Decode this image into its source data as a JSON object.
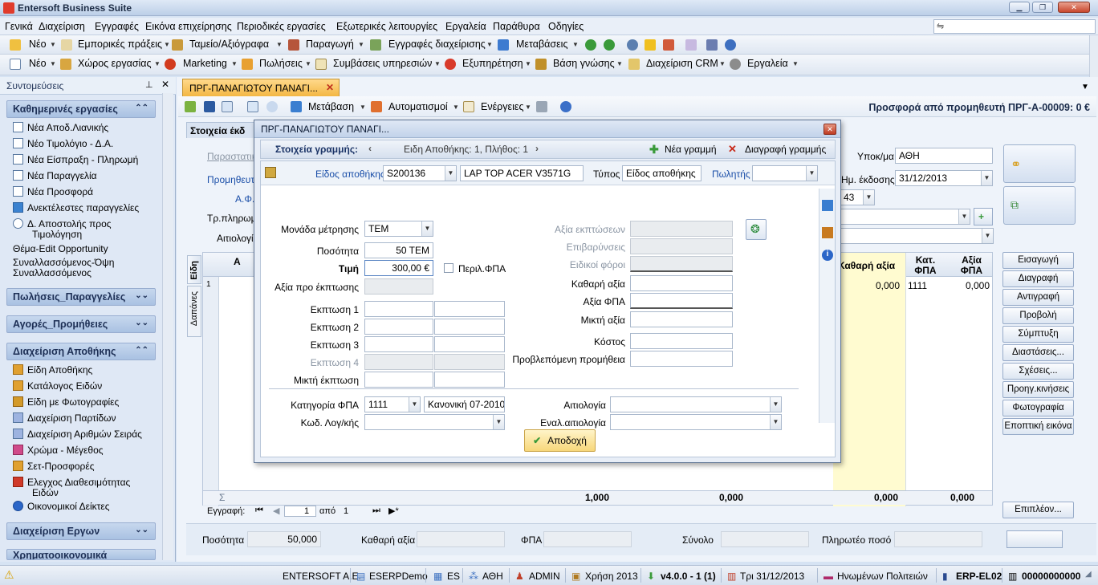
{
  "window": {
    "title": "Entersoft Business Suite"
  },
  "menu": [
    "Γενικά",
    "Διαχείριση",
    "Εγγραφές",
    "Εικόνα επιχείρησης",
    "Περιοδικές εργασίες",
    "Εξωτερικές λειτουργίες",
    "Εργαλεία",
    "Παράθυρα",
    "Οδηγίες"
  ],
  "toolbar1": [
    "Νέο",
    "Εμπορικές πράξεις",
    "Ταμείο/Αξιόγραφα",
    "Παραγωγή",
    "Εγγραφές διαχείρισης",
    "Μεταβάσεις"
  ],
  "toolbar2": [
    "Νέο",
    "Χώρος εργασίας",
    "Marketing",
    "Πωλήσεις",
    "Συμβάσεις υπηρεσιών",
    "Εξυπηρέτηση",
    "Βάση γνώσης",
    "Διαχείριση CRM",
    "Εργαλεία"
  ],
  "left": {
    "header": "Συντομεύσεις",
    "groups": [
      {
        "title": "Καθημερινές εργασίες",
        "items": [
          "Νέα Αποδ.Λιανικής",
          "Νέο Τιμολόγιο - Δ.Α.",
          "Νέα Είσπραξη - Πληρωμή",
          "Νέα Παραγγελία",
          "Νέα Προσφορά",
          "Ανεκτέλεστες παραγγελίες",
          "Δ. Αποστολής προς",
          "Τιμολόγηση",
          "Θέμα-Edit Opportunity",
          "Συναλλασσόμενος-Όψη",
          "Συναλλασσόμενος"
        ]
      },
      {
        "title": "Πωλήσεις_Παραγγελίες"
      },
      {
        "title": "Αγορές_Προμήθειες"
      },
      {
        "title": "Διαχείριση Αποθήκης",
        "items": [
          "Είδη Αποθήκης",
          "Κατάλογος Ειδών",
          "Είδη με Φωτογραφίες",
          "Διαχείριση Παρτίδων",
          "Διαχείριση Αριθμών Σειράς",
          "Χρώμα - Μέγεθος",
          "Σετ-Προσφορές",
          "Ελεγχος Διαθεσιμότητας",
          "Ειδών",
          "Οικονομικοί Δείκτες"
        ]
      },
      {
        "title": "Διαχείριση Εργων"
      },
      {
        "title": "Χρηματοοικονομικά"
      }
    ]
  },
  "doc": {
    "tab_label": "ΠΡΓ-ΠΑΝΑΓΙΩΤΟΥ ΠΑΝΑΓΙ...",
    "toolbar": [
      "Μετάβαση",
      "Αυτοματισμοί",
      "Ενέργειες"
    ],
    "title": "Προσφορά από προμηθευτή ΠΡΓ-Α-00009: 0 €",
    "fields": {
      "section": "Στοιχεία έκδ",
      "lbl_parast": "Παραστατικό",
      "lbl_prom": "Προμηθευτής",
      "lbl_afm": "Α.Φ.Μ.",
      "lbl_trpl": "Τρ.πληρωμής",
      "lbl_aitiol": "Αιτιολογία",
      "lbl_ypok": "Υποκ/μα",
      "ypok": "ΑΘΗ",
      "lbl_date": "Ημ. έκδοσης",
      "date": "31/12/2013",
      "small": "43"
    },
    "grid": {
      "col_a": "A",
      "col_net": "Καθαρή αξία",
      "col_kat": "Κατ. ΦΠΑ",
      "col_vat": "Αξία ΦΠΑ",
      "row_no": "1",
      "row_net": "0,000",
      "row_kat": "1111",
      "row_vat": "0,000",
      "sum_sym": "Σ",
      "sum_qty": "1,000",
      "sum_a": "0,000",
      "sum_net": "0,000",
      "sum_vat": "0,000",
      "tab1": "Είδη",
      "tab2": "Δαπάνες",
      "nav_label": "Εγγραφή:",
      "nav_pos": "1",
      "nav_of": "από",
      "nav_total": "1"
    },
    "right_buttons": [
      "Εισαγωγή",
      "Διαγραφή",
      "Αντιγραφή",
      "Προβολή",
      "Σύμπτυξη",
      "Διαστάσεις...",
      "Σχέσεις...",
      "Προηγ.κινήσεις",
      "Φωτογραφία",
      "Εποπτική εικόνα"
    ],
    "more_button": "Επιπλέον...",
    "bottom": {
      "qty_label": "Ποσότητα",
      "qty": "50,000",
      "net_label": "Καθαρή αξία",
      "vat_label": "ΦΠΑ",
      "total_label": "Σύνολο",
      "pay_label": "Πληρωτέο ποσό"
    }
  },
  "dialog": {
    "title": "ΠΡΓ-ΠΑΝΑΓΙΩΤΟΥ ΠΑΝΑΓΙ...",
    "nav_title": "Στοιχεία γραμμής:",
    "nav_info": "Ειδη Αποθήκης: 1, Πλήθος: 1",
    "new_line": "Νέα γραμμή",
    "delete_line": "Διαγραφή γραμμής",
    "item_label": "Είδος αποθήκης",
    "item_code": "S200136",
    "item_name": "LAP TOP ACER V3571G",
    "type_label": "Τύπος",
    "type_value": "Είδος αποθήκης",
    "seller_label": "Πωλητής",
    "unit_label": "Μονάδα μέτρησης",
    "unit_value": "TEM",
    "qty_label": "Ποσότητα",
    "qty_value": "50 TEM",
    "price_label": "Τιμή",
    "price_value": "300,00 €",
    "vat_incl_label": "Περιλ.ΦΠΑ",
    "value_before_label": "Αξία προ έκπτωσης",
    "disc1": "Εκπτωση 1",
    "disc2": "Εκπτωση 2",
    "disc3": "Εκπτωση 3",
    "disc4": "Εκπτωση 4",
    "mixed_disc": "Μικτή έκπτωση",
    "disc_value_label": "Αξία εκπτώσεων",
    "charges_label": "Επιβαρύνσεις",
    "special_tax_label": "Ειδικοί φόροι",
    "net_label": "Καθαρή αξία",
    "vat_label": "Αξία ΦΠΑ",
    "gross_label": "Μικτή αξία",
    "cost_label": "Κόστος",
    "commission_label": "Προβλεπόμενη προμήθεια",
    "vat_cat_label": "Κατηγορία ΦΠΑ",
    "vat_cat_code": "1111",
    "vat_cat_name": "Κανονική 07-2010",
    "account_label": "Κωδ. Λογ/κής",
    "reason_label": "Αιτιολογία",
    "alt_reason_label": "Εναλ.αιτιολογία",
    "ok": "Αποδοχή"
  },
  "status": [
    "ENTERSOFT A.E.",
    "ESERPDemo",
    "ES",
    "ΑΘΗ",
    "ADMIN",
    "Χρήση 2013",
    "v4.0.0 - 1 (1)",
    "Τρι 31/12/2013",
    "Ηνωμένων Πολιτειών",
    "ERP-EL02",
    "00000000000"
  ],
  "colors": {
    "accent_tab": "#f3b744",
    "dialog_border": "#5f7594",
    "nav_blue": "#1a4ea8"
  }
}
